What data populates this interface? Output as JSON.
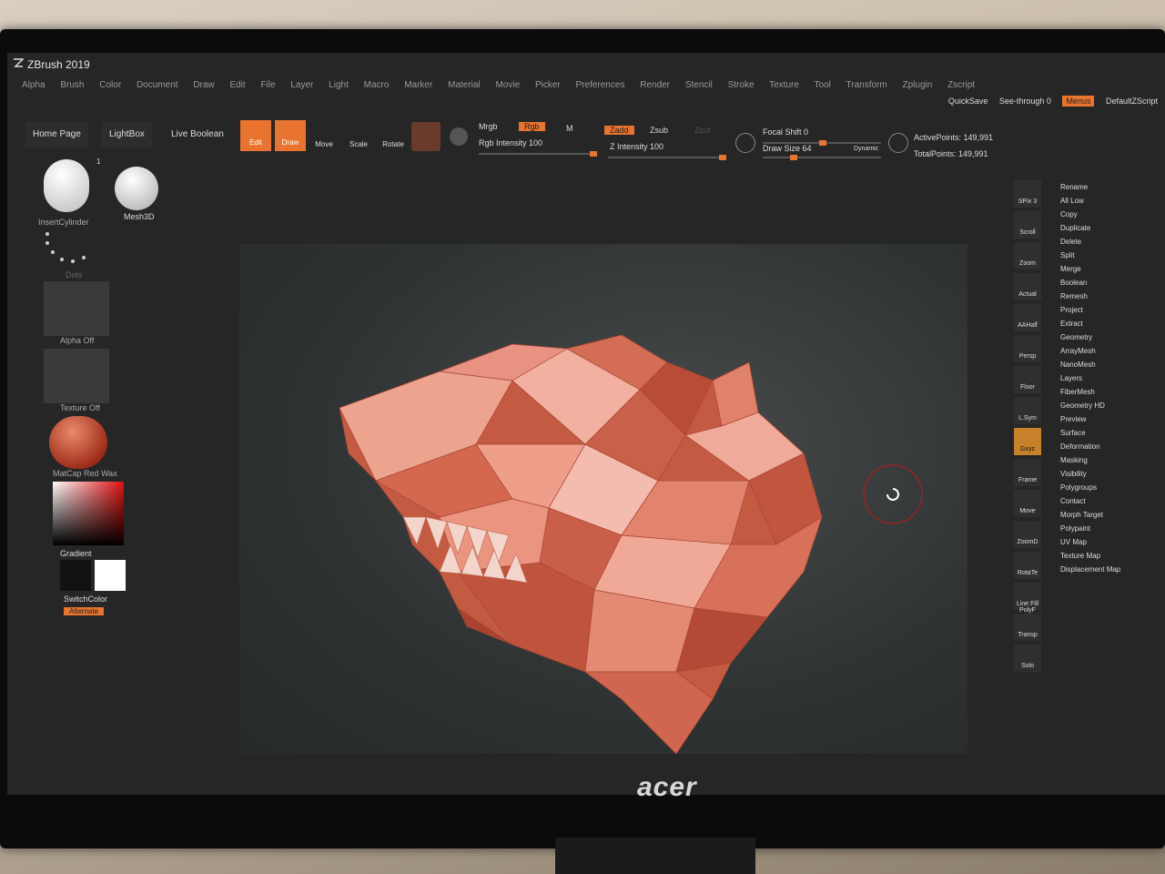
{
  "app": {
    "title": "ZBrush 2019",
    "brand": "acer"
  },
  "menu": [
    "Alpha",
    "Brush",
    "Color",
    "Document",
    "Draw",
    "Edit",
    "File",
    "Layer",
    "Light",
    "Macro",
    "Marker",
    "Material",
    "Movie",
    "Picker",
    "Preferences",
    "Render",
    "Stencil",
    "Stroke",
    "Texture",
    "Tool",
    "Transform",
    "Zplugin",
    "Zscript"
  ],
  "topright": {
    "quicksave": "QuickSave",
    "seethrough": "See-through  0",
    "menus": "Menus",
    "script": "DefaultZScript"
  },
  "toolbar": {
    "homepage": "Home Page",
    "lightbox": "LightBox",
    "liveboolean": "Live Boolean",
    "edit": "Edit",
    "draw": "Draw",
    "move": "Move",
    "scale": "Scale",
    "rotate": "Rotate",
    "mrgb": "Mrgb",
    "rgb": "Rgb",
    "m": "M",
    "rgbintensity": "Rgb Intensity 100",
    "zadd": "Zadd",
    "zsub": "Zsub",
    "zcut": "Zcut",
    "zintensity": "Z Intensity 100",
    "focalshift": "Focal Shift 0",
    "drawsize": "Draw Size 64",
    "dynamic": "Dynamic",
    "activepoints": "ActivePoints: 149,991",
    "totalpoints": "TotalPoints: 149,991"
  },
  "left": {
    "insert": "InsertCylinder",
    "mesh3d": "Mesh3D",
    "dots": "Dots",
    "alpha": "Alpha Off",
    "texture": "Texture Off",
    "matcap": "MatCap Red Wax",
    "gradient": "Gradient",
    "switchcolor": "SwitchColor",
    "alternate": "Alternate",
    "count": "1"
  },
  "rightlist": [
    "Rename",
    "All Low",
    "Copy",
    "Duplicate",
    "Delete",
    "Split",
    "Merge",
    "Boolean",
    "Remesh",
    "Project",
    "Extract",
    "Geometry",
    "ArrayMesh",
    "NanoMesh",
    "Layers",
    "FiberMesh",
    "Geometry HD",
    "Preview",
    "Surface",
    "Deformation",
    "Masking",
    "Visibility",
    "Polygroups",
    "Contact",
    "Morph Target",
    "Polypaint",
    "UV Map",
    "Texture Map",
    "Displacement Map"
  ],
  "righticons": [
    "SPix 3",
    "Scroll",
    "Zoom",
    "Actual",
    "AAHalf",
    "Persp",
    "Floor",
    "L.Sym",
    "Gxyz",
    "Frame",
    "Move",
    "ZoomD",
    "RotaTe",
    "Line Fill PolyF",
    "Transp",
    "Solo"
  ],
  "colors": {
    "accent": "#e8742f",
    "wolf": "#d9705a"
  }
}
